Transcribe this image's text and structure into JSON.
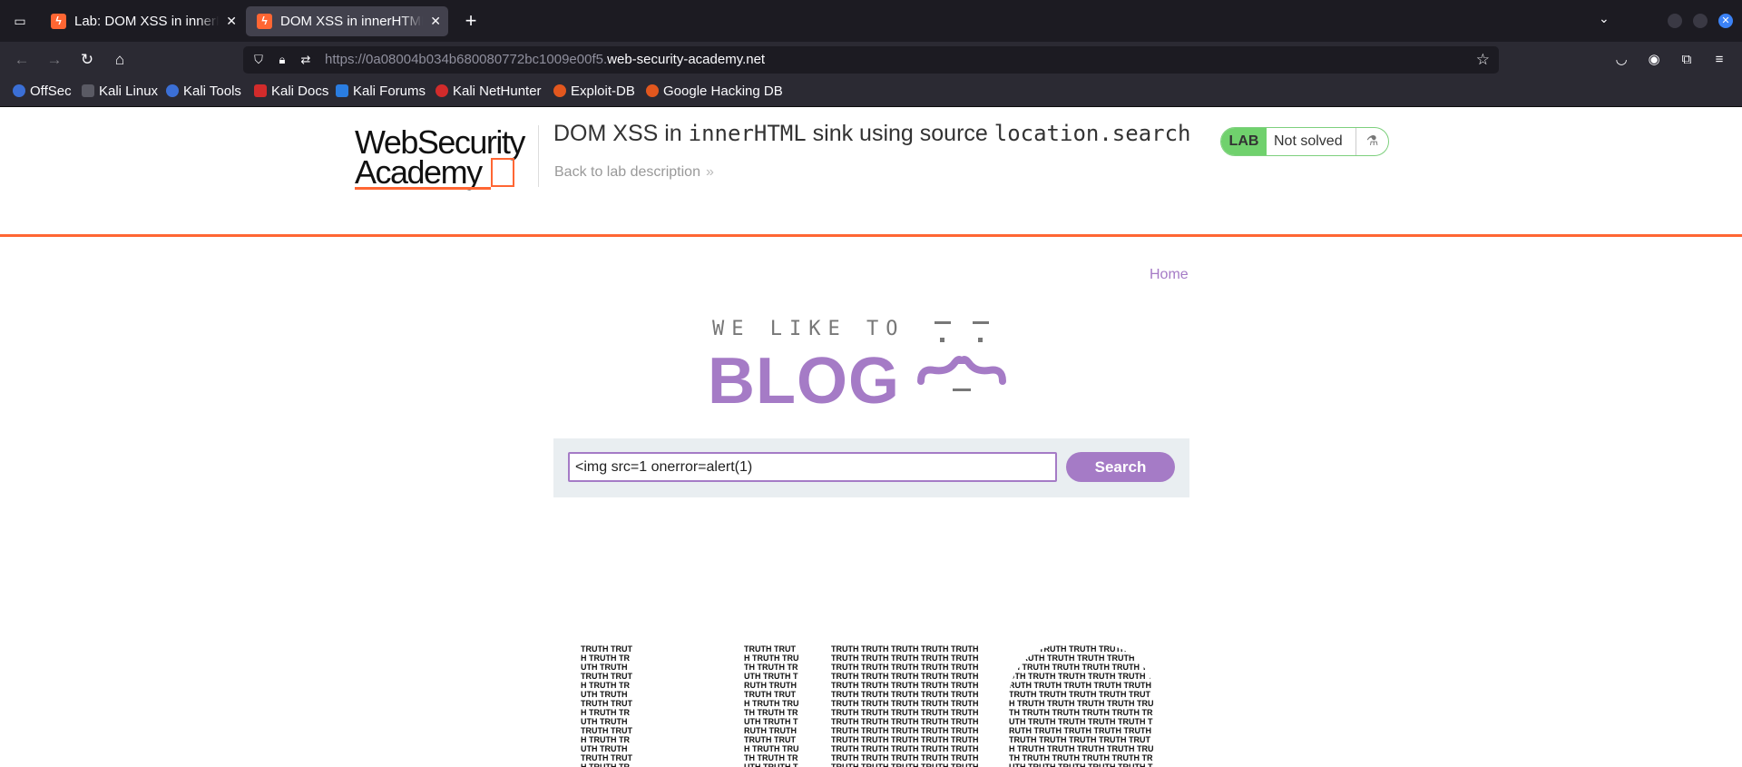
{
  "browser": {
    "tabs": [
      {
        "title": "Lab: DOM XSS in innerHTML sink using source location.search",
        "active": false
      },
      {
        "title": "DOM XSS in innerHTML sink using source location.search",
        "active": true
      }
    ],
    "url_prefix": "https://0a08004b034b680080772bc1009e00f5.",
    "url_domain": "web-security-academy.net",
    "bookmarks": [
      {
        "label": "OffSec",
        "icon": "offsec-icon",
        "color": "#3b6fd6"
      },
      {
        "label": "Kali Linux",
        "icon": "kali-dragon-icon",
        "color": "#2b2a33"
      },
      {
        "label": "Kali Tools",
        "icon": "kali-tools-icon",
        "color": "#3b6fd6"
      },
      {
        "label": "Kali Docs",
        "icon": "kali-docs-icon",
        "color": "#d22b2b"
      },
      {
        "label": "Kali Forums",
        "icon": "kali-forums-icon",
        "color": "#2a7de1"
      },
      {
        "label": "Kali NetHunter",
        "icon": "nethunter-icon",
        "color": "#d22b2b"
      },
      {
        "label": "Exploit-DB",
        "icon": "exploit-db-icon",
        "color": "#e2571e"
      },
      {
        "label": "Google Hacking DB",
        "icon": "ghdb-icon",
        "color": "#e2571e"
      }
    ]
  },
  "academy": {
    "logo_line1": "WebSecurity",
    "logo_line2": "Academy",
    "lab_title_prefix": "DOM XSS in ",
    "lab_title_code1": "innerHTML",
    "lab_title_mid": " sink using source ",
    "lab_title_code2": "location.search",
    "back_link": "Back to lab description",
    "status_badge": "LAB",
    "status_text": "Not solved",
    "accent_color": "#ff6633"
  },
  "blog": {
    "nav_home": "Home",
    "banner_top": "WE LIKE TO",
    "banner_main": "BLOG",
    "search_value": "<img src=1 onerror=alert(1)",
    "search_button": "Search",
    "brand_color": "#a57bc6",
    "post_image_word": "TRUTH"
  }
}
